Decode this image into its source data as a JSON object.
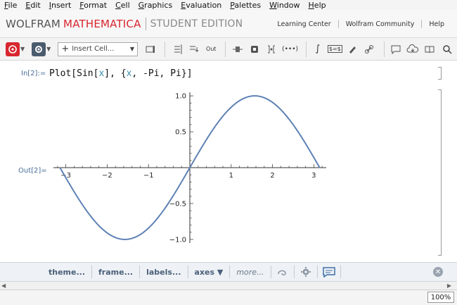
{
  "menu": {
    "items": [
      {
        "u": "F",
        "rest": "ile"
      },
      {
        "u": "E",
        "rest": "dit"
      },
      {
        "u": "I",
        "rest": "nsert"
      },
      {
        "u": "F",
        "rest": "ormat"
      },
      {
        "u": "C",
        "rest": "ell"
      },
      {
        "u": "G",
        "rest": "raphics"
      },
      {
        "u": "E",
        "rest": "valuation"
      },
      {
        "u": "P",
        "rest": "alettes"
      },
      {
        "u": "W",
        "rest": "indow"
      },
      {
        "u": "H",
        "rest": "elp"
      }
    ]
  },
  "brand": {
    "wolfram": "WOLFRAM",
    "mathematica": "MATHEMATICA",
    "edition": "STUDENT EDITION",
    "links": [
      "Learning Center",
      "Wolfram Community",
      "Help"
    ]
  },
  "toolbar": {
    "insert_cell": "Insert Cell...",
    "icons": [
      "stop-icon",
      "gear-icon",
      "cell-icon",
      "bracket-icon",
      "indent-icon",
      "output-icon",
      "move-icon",
      "input-icon",
      "group-icon",
      "link-code-icon",
      "integral-icon",
      "formula-icon",
      "pen-icon",
      "chain-icon",
      "comment-icon",
      "chat-icon",
      "cloud-icon",
      "book-icon",
      "search-icon"
    ],
    "output_label": "Out",
    "formula_label": "$=$"
  },
  "notebook": {
    "in_label": "In[2]:=",
    "code_plot": "Plot[Sin[",
    "code_x1": "x",
    "code_mid": "], {",
    "code_x2": "x",
    "code_end": ", -Pi, Pi}]",
    "out_label": "Out[2]="
  },
  "chart_data": {
    "type": "line",
    "function": "Sin[x]",
    "x_range": [
      -3.14159,
      3.14159
    ],
    "xlim": [
      -3.3,
      3.3
    ],
    "ylim": [
      -1.05,
      1.05
    ],
    "x_ticks": [
      -3,
      -2,
      -1,
      1,
      2,
      3
    ],
    "x_tick_labels": [
      "−3",
      "−2",
      "−1",
      "1",
      "2",
      "3"
    ],
    "y_ticks": [
      -1.0,
      -0.5,
      0.5,
      1.0
    ],
    "y_tick_labels": [
      "−1.0",
      "−0.5",
      "0.5",
      "1.0"
    ],
    "series": [
      {
        "x": [
          -3.14159,
          -2.5,
          -2.0,
          -1.5708,
          -1.0,
          -0.5,
          0,
          0.5,
          1.0,
          1.5708,
          2.0,
          2.5,
          3.14159
        ],
        "y": [
          0,
          -0.598,
          -0.909,
          -1.0,
          -0.841,
          -0.479,
          0,
          0.479,
          0.841,
          1.0,
          0.909,
          0.598,
          0
        ]
      }
    ],
    "line_color": "#5e81b5",
    "title": "",
    "xlabel": "",
    "ylabel": ""
  },
  "suggestions": {
    "items": [
      "theme...",
      "frame...",
      "labels...",
      "axes ▼",
      "more..."
    ]
  },
  "status": {
    "zoom": "100%"
  },
  "colors": {
    "brand_red": "#d8262f",
    "label_blue": "#4a6f9a",
    "variable_teal": "#3a8fa8"
  }
}
